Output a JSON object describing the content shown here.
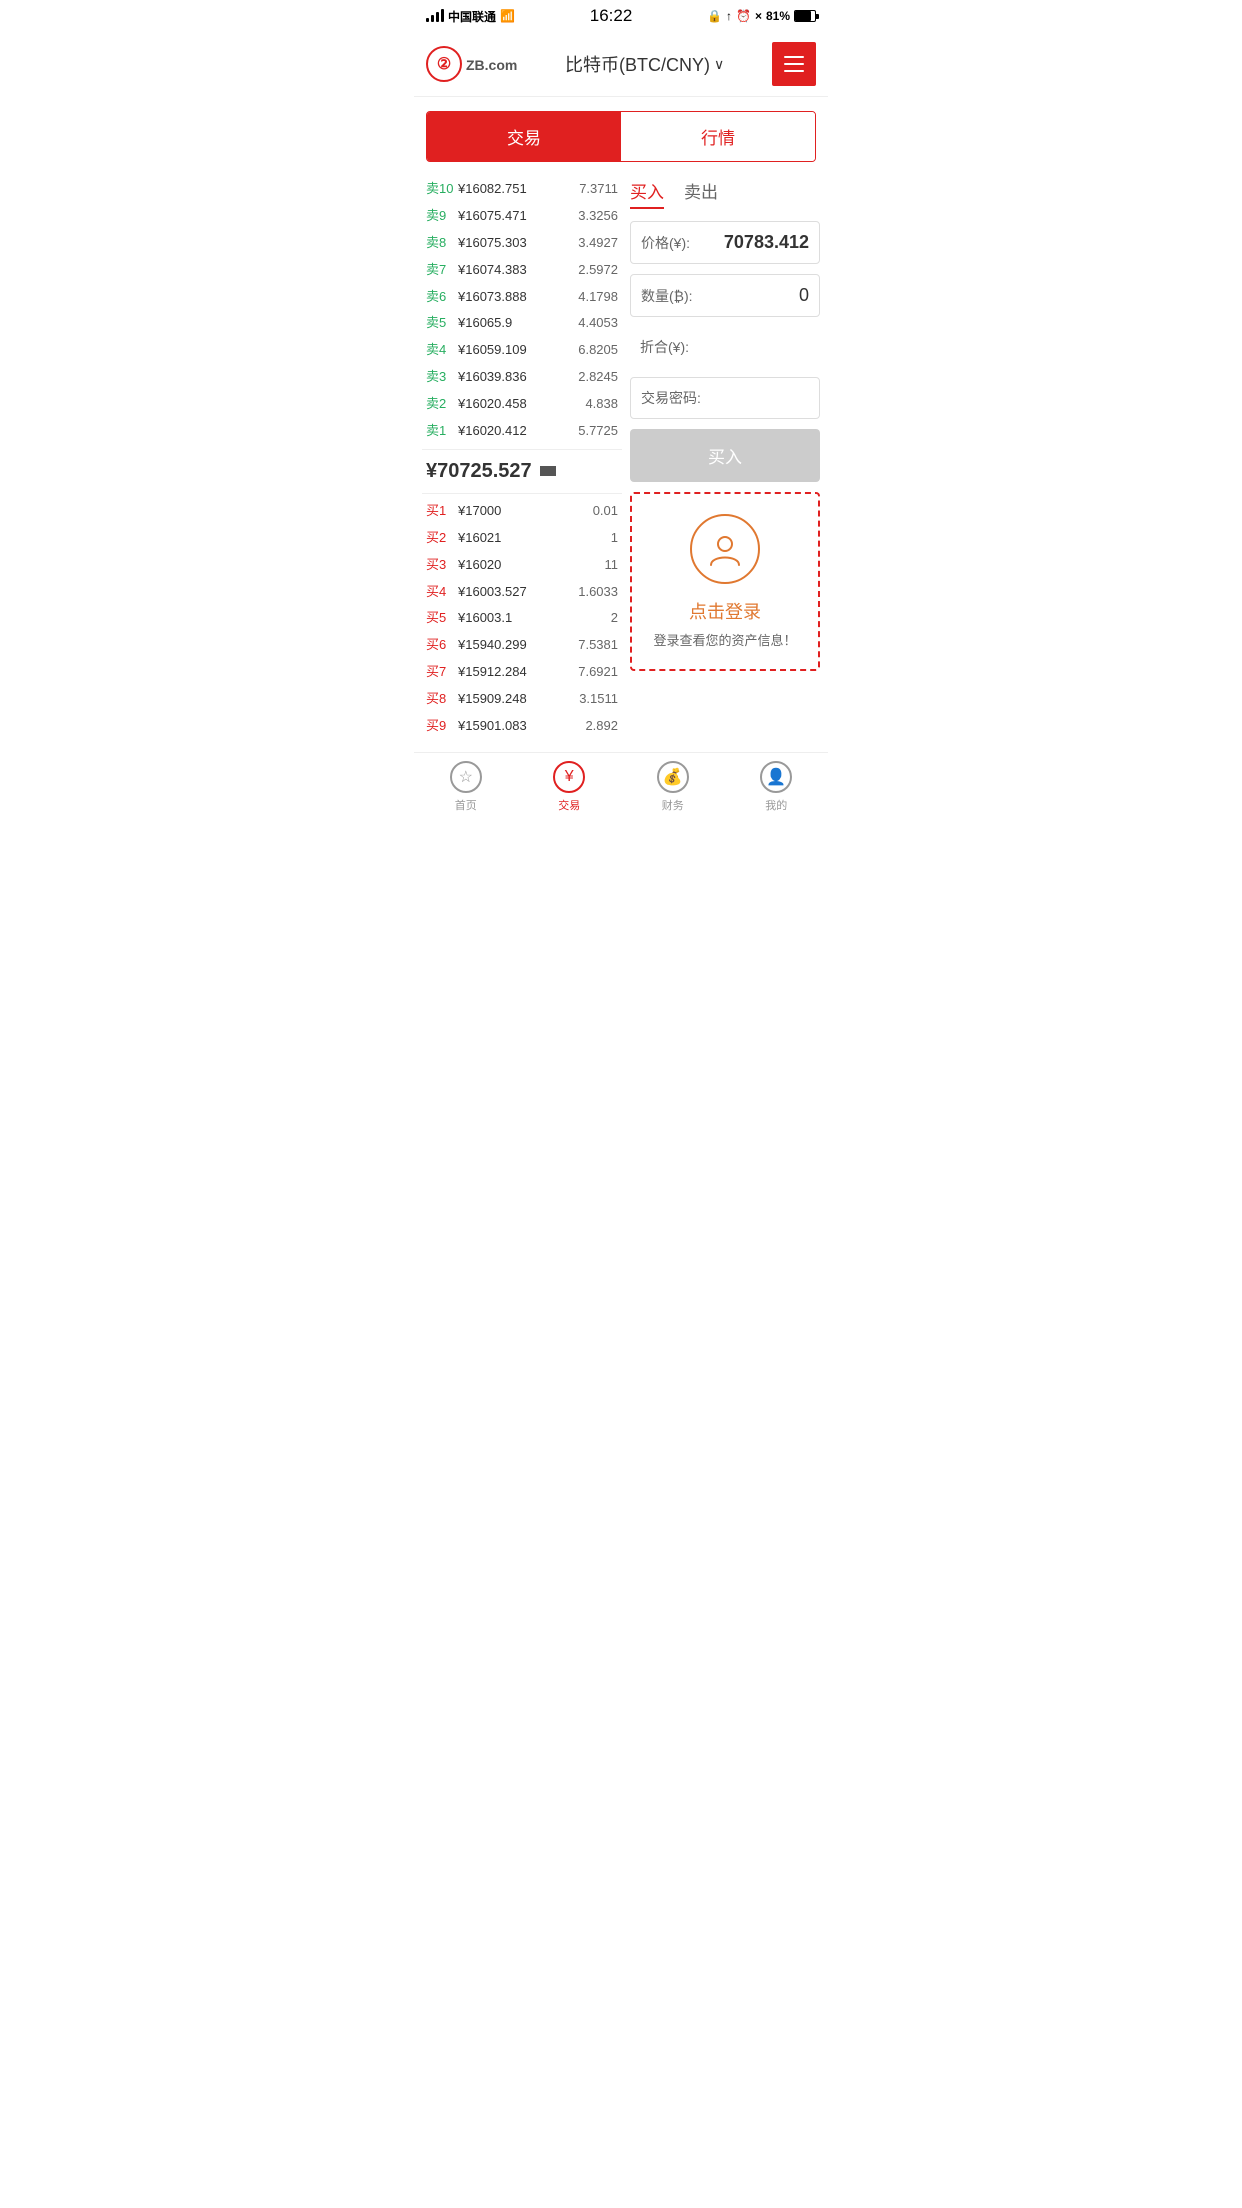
{
  "statusBar": {
    "carrier": "中国联通",
    "time": "16:22",
    "battery": "81%"
  },
  "header": {
    "logoText": "ZB",
    "logoDomain": ".com",
    "title": "比特币(BTC/CNY)",
    "menuAriaLabel": "menu"
  },
  "tabs": {
    "tab1": "交易",
    "tab2": "行情"
  },
  "orderBook": {
    "sells": [
      {
        "label": "卖10",
        "price": "¥16082.751",
        "amount": "7.3711"
      },
      {
        "label": "卖9",
        "price": "¥16075.471",
        "amount": "3.3256"
      },
      {
        "label": "卖8",
        "price": "¥16075.303",
        "amount": "3.4927"
      },
      {
        "label": "卖7",
        "price": "¥16074.383",
        "amount": "2.5972"
      },
      {
        "label": "卖6",
        "price": "¥16073.888",
        "amount": "4.1798"
      },
      {
        "label": "卖5",
        "price": "¥16065.9",
        "amount": "4.4053"
      },
      {
        "label": "卖4",
        "price": "¥16059.109",
        "amount": "6.8205"
      },
      {
        "label": "卖3",
        "price": "¥16039.836",
        "amount": "2.8245"
      },
      {
        "label": "卖2",
        "price": "¥16020.458",
        "amount": "4.838"
      },
      {
        "label": "卖1",
        "price": "¥16020.412",
        "amount": "5.7725"
      }
    ],
    "currentPrice": "¥70725.527",
    "buys": [
      {
        "label": "买1",
        "price": "¥17000",
        "amount": "0.01"
      },
      {
        "label": "买2",
        "price": "¥16021",
        "amount": "1"
      },
      {
        "label": "买3",
        "price": "¥16020",
        "amount": "11"
      },
      {
        "label": "买4",
        "price": "¥16003.527",
        "amount": "1.6033"
      },
      {
        "label": "买5",
        "price": "¥16003.1",
        "amount": "2"
      },
      {
        "label": "买6",
        "price": "¥15940.299",
        "amount": "7.5381"
      },
      {
        "label": "买7",
        "price": "¥15912.284",
        "amount": "7.6921"
      },
      {
        "label": "买8",
        "price": "¥15909.248",
        "amount": "3.1511"
      },
      {
        "label": "买9",
        "price": "¥15901.083",
        "amount": "2.892"
      }
    ]
  },
  "tradePanel": {
    "buyTab": "买入",
    "sellTab": "卖出",
    "priceLabel": "价格(¥):",
    "priceValue": "70783.412",
    "quantityLabel": "数量(₿):",
    "quantityValue": "0",
    "totalLabel": "折合(¥):",
    "totalValue": "",
    "passwordLabel": "交易密码:",
    "passwordValue": "",
    "buyBtnLabel": "买入"
  },
  "loginBox": {
    "loginText": "点击登录",
    "loginHint": "登录查看您的资产信息！"
  },
  "bottomNav": [
    {
      "label": "首页",
      "icon": "star",
      "active": false
    },
    {
      "label": "交易",
      "icon": "yen",
      "active": true
    },
    {
      "label": "财务",
      "icon": "finance",
      "active": false
    },
    {
      "label": "我的",
      "icon": "user",
      "active": false
    }
  ]
}
